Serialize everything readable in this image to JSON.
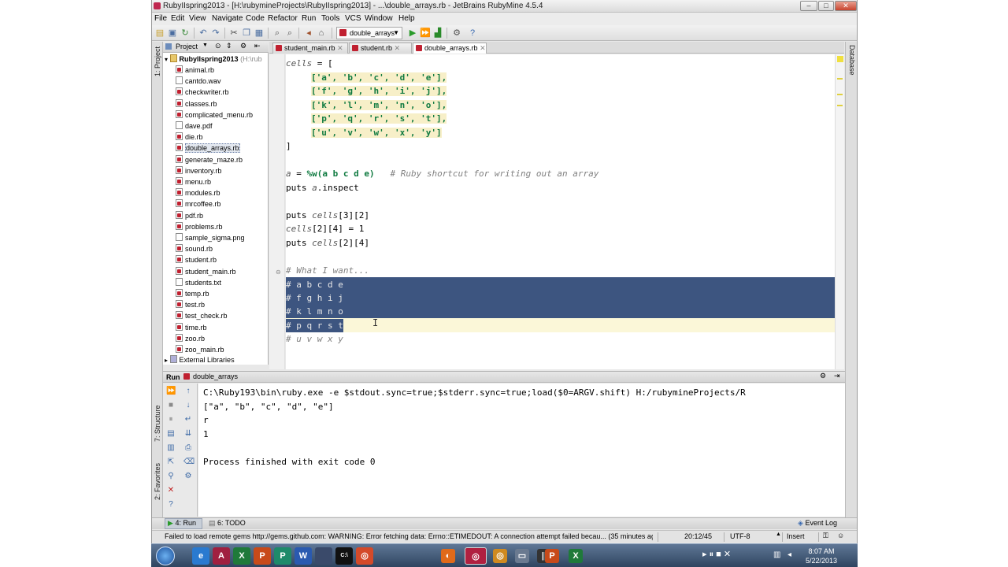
{
  "window": {
    "title": "RubyIIspring2013 - [H:\\rubymineProjects\\RubyIIspring2013] - ...\\double_arrays.rb - JetBrains RubyMine 4.5.4",
    "controls": [
      "–",
      "□",
      "✕"
    ]
  },
  "menu": [
    "File",
    "Edit",
    "View",
    "Navigate",
    "Code",
    "Refactor",
    "Run",
    "Tools",
    "VCS",
    "Window",
    "Help"
  ],
  "toolbar": {
    "run_config": "double_arrays"
  },
  "side_tabs": {
    "project": "1: Project",
    "structure": "7: Structure",
    "favorites": "2: Favorites",
    "database": "Database"
  },
  "project": {
    "header": "Project",
    "root": "RubyIIspring2013",
    "root_path": "(H:\\rub",
    "files": [
      "animal.rb",
      "cantdo.wav",
      "checkwriter.rb",
      "classes.rb",
      "complicated_menu.rb",
      "dave.pdf",
      "die.rb",
      "double_arrays.rb",
      "generate_maze.rb",
      "inventory.rb",
      "menu.rb",
      "modules.rb",
      "mrcoffee.rb",
      "pdf.rb",
      "problems.rb",
      "sample_sigma.png",
      "sound.rb",
      "student.rb",
      "student_main.rb",
      "students.txt",
      "temp.rb",
      "test.rb",
      "test_check.rb",
      "time.rb",
      "zoo.rb",
      "zoo_main.rb"
    ],
    "external": "External Libraries",
    "selected": "double_arrays.rb"
  },
  "tabs": [
    "student_main.rb",
    "student.rb",
    "double_arrays.rb"
  ],
  "code": {
    "l1_var": "cells",
    "l1_rest": " = [",
    "row1": "['a', 'b', 'c', 'd', 'e'],",
    "row2": "['f', 'g', 'h', 'i', 'j'],",
    "row3": "['k', 'l', 'm', 'n', 'o'],",
    "row4": "['p', 'q', 'r', 's', 't'],",
    "row5": "['u', 'v', 'w', 'x', 'y']",
    "close": "]",
    "a_var": "a",
    "a_eq": " = ",
    "a_pct": "%w(a b c d e)",
    "a_cmt": "   # Ruby shortcut for writing out an array",
    "p1_kw": "puts ",
    "p1_var": "a",
    "p1_rest": ".inspect",
    "p2_kw": "puts ",
    "p2_var": "cells",
    "p2_rest": "[3][2]",
    "as_var": "cells",
    "as_rest": "[2][4] = 1",
    "p3_kw": "puts ",
    "p3_var": "cells",
    "p3_rest": "[2][4]",
    "cmt1": "# What I want...",
    "sel1": "# a b c d e",
    "sel2": "# f g h i j",
    "sel3": "# k l m n o",
    "sel4": "# p q r s t",
    "cmt6": "# u v w x y"
  },
  "run": {
    "header_label": "Run",
    "config": "double_arrays",
    "output": [
      "C:\\Ruby193\\bin\\ruby.exe -e $stdout.sync=true;$stderr.sync=true;load($0=ARGV.shift) H:/rubymineProjects/R",
      "[\"a\", \"b\", \"c\", \"d\", \"e\"]",
      "r",
      "1",
      "",
      "Process finished with exit code 0"
    ]
  },
  "bottom_tabs": {
    "run": "4: Run",
    "todo": "6: TODO",
    "event_log": "Event Log"
  },
  "status": {
    "message": "Failed to load remote gems http://gems.github.com: WARNING:  Error fetching data: Errno::ETIMEDOUT: A connection attempt failed becau... (35 minutes ago)",
    "position": "20:12/45",
    "encoding": "UTF-8",
    "mode": "Insert"
  },
  "taskbar": {
    "apps": [
      "e",
      "A",
      "X",
      "P",
      "P",
      "W",
      "",
      "C:\\",
      "◎"
    ],
    "tray": [
      "◐",
      "◎",
      "▭",
      "||",
      "P",
      "X"
    ],
    "time": "8:07 AM",
    "date": "5/22/2013"
  }
}
